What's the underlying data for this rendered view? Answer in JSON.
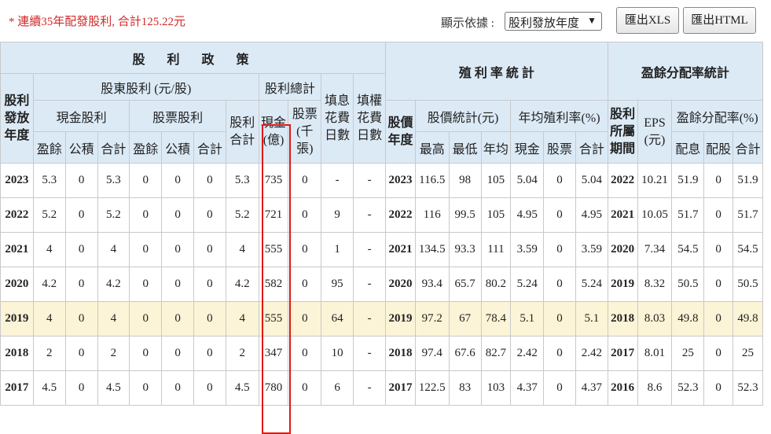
{
  "toolbar": {
    "note": "* 連續35年配發股利, 合計125.22元",
    "display_label": "顯示依據 :",
    "display_select": "股利發放年度",
    "export_xls": "匯出XLS",
    "export_html": "匯出HTML"
  },
  "headers": {
    "policy": "股　利　政　策",
    "yield_stats": "殖 利 率 統 計",
    "payout_stats": "盈餘分配率統計",
    "issue_year": "股利發放年度",
    "shareholder_dividend": "股東股利 (元/股)",
    "total_dividend": "股利總計",
    "fill_days": "填息花費日數",
    "fill_right_days": "填權花費日數",
    "price_year": "股價年度",
    "price_stats": "股價統計(元)",
    "annual_yield": "年均殖利率(%)",
    "belong_period": "股利所屬期間",
    "eps": "EPS (元)",
    "payout_ratio": "盈餘分配率(%)",
    "cash_dividend": "現金股利",
    "stock_dividend": "股票股利",
    "dividend_sum": "股利合計",
    "cash_total": "現金(億)",
    "stock_total": "股票(千張)",
    "sub": {
      "earnings": "盈餘",
      "reserve": "公積",
      "sum": "合計",
      "high": "最高",
      "low": "最低",
      "avg": "年均",
      "cash": "現金",
      "stock": "股票",
      "payout_cash": "配息",
      "payout_stock": "配股"
    }
  },
  "rows": [
    {
      "y": "2023",
      "ce": "5.3",
      "cr": "0",
      "cs": "5.3",
      "se": "0",
      "sr": "0",
      "ss": "0",
      "ds": "5.3",
      "ct": "735",
      "st": "0",
      "fd": "-",
      "fr": "-",
      "py": "2023",
      "hi": "116.5",
      "lo": "98",
      "av": "105",
      "yc": "5.04",
      "ys": "0",
      "yt": "5.04",
      "bp": "2022",
      "eps": "10.21",
      "pc": "51.9",
      "ps": "0",
      "pt": "51.9"
    },
    {
      "y": "2022",
      "ce": "5.2",
      "cr": "0",
      "cs": "5.2",
      "se": "0",
      "sr": "0",
      "ss": "0",
      "ds": "5.2",
      "ct": "721",
      "st": "0",
      "fd": "9",
      "fr": "-",
      "py": "2022",
      "hi": "116",
      "lo": "99.5",
      "av": "105",
      "yc": "4.95",
      "ys": "0",
      "yt": "4.95",
      "bp": "2021",
      "eps": "10.05",
      "pc": "51.7",
      "ps": "0",
      "pt": "51.7"
    },
    {
      "y": "2021",
      "ce": "4",
      "cr": "0",
      "cs": "4",
      "se": "0",
      "sr": "0",
      "ss": "0",
      "ds": "4",
      "ct": "555",
      "st": "0",
      "fd": "1",
      "fr": "-",
      "py": "2021",
      "hi": "134.5",
      "lo": "93.3",
      "av": "111",
      "yc": "3.59",
      "ys": "0",
      "yt": "3.59",
      "bp": "2020",
      "eps": "7.34",
      "pc": "54.5",
      "ps": "0",
      "pt": "54.5"
    },
    {
      "y": "2020",
      "ce": "4.2",
      "cr": "0",
      "cs": "4.2",
      "se": "0",
      "sr": "0",
      "ss": "0",
      "ds": "4.2",
      "ct": "582",
      "st": "0",
      "fd": "95",
      "fr": "-",
      "py": "2020",
      "hi": "93.4",
      "lo": "65.7",
      "av": "80.2",
      "yc": "5.24",
      "ys": "0",
      "yt": "5.24",
      "bp": "2019",
      "eps": "8.32",
      "pc": "50.5",
      "ps": "0",
      "pt": "50.5"
    },
    {
      "y": "2019",
      "ce": "4",
      "cr": "0",
      "cs": "4",
      "se": "0",
      "sr": "0",
      "ss": "0",
      "ds": "4",
      "ct": "555",
      "st": "0",
      "fd": "64",
      "fr": "-",
      "py": "2019",
      "hi": "97.2",
      "lo": "67",
      "av": "78.4",
      "yc": "5.1",
      "ys": "0",
      "yt": "5.1",
      "bp": "2018",
      "eps": "8.03",
      "pc": "49.8",
      "ps": "0",
      "pt": "49.8"
    },
    {
      "y": "2018",
      "ce": "2",
      "cr": "0",
      "cs": "2",
      "se": "0",
      "sr": "0",
      "ss": "0",
      "ds": "2",
      "ct": "347",
      "st": "0",
      "fd": "10",
      "fr": "-",
      "py": "2018",
      "hi": "97.4",
      "lo": "67.6",
      "av": "82.7",
      "yc": "2.42",
      "ys": "0",
      "yt": "2.42",
      "bp": "2017",
      "eps": "8.01",
      "pc": "25",
      "ps": "0",
      "pt": "25"
    },
    {
      "y": "2017",
      "ce": "4.5",
      "cr": "0",
      "cs": "4.5",
      "se": "0",
      "sr": "0",
      "ss": "0",
      "ds": "4.5",
      "ct": "780",
      "st": "0",
      "fd": "6",
      "fr": "-",
      "py": "2017",
      "hi": "122.5",
      "lo": "83",
      "av": "103",
      "yc": "4.37",
      "ys": "0",
      "yt": "4.37",
      "bp": "2016",
      "eps": "8.6",
      "pc": "52.3",
      "ps": "0",
      "pt": "52.3"
    }
  ],
  "highlighted_row": "2019",
  "highlight_color": "#fcf4d7",
  "header_color": "#dceaf6",
  "note_color": "#d22a2a",
  "box_color": "#e01818"
}
